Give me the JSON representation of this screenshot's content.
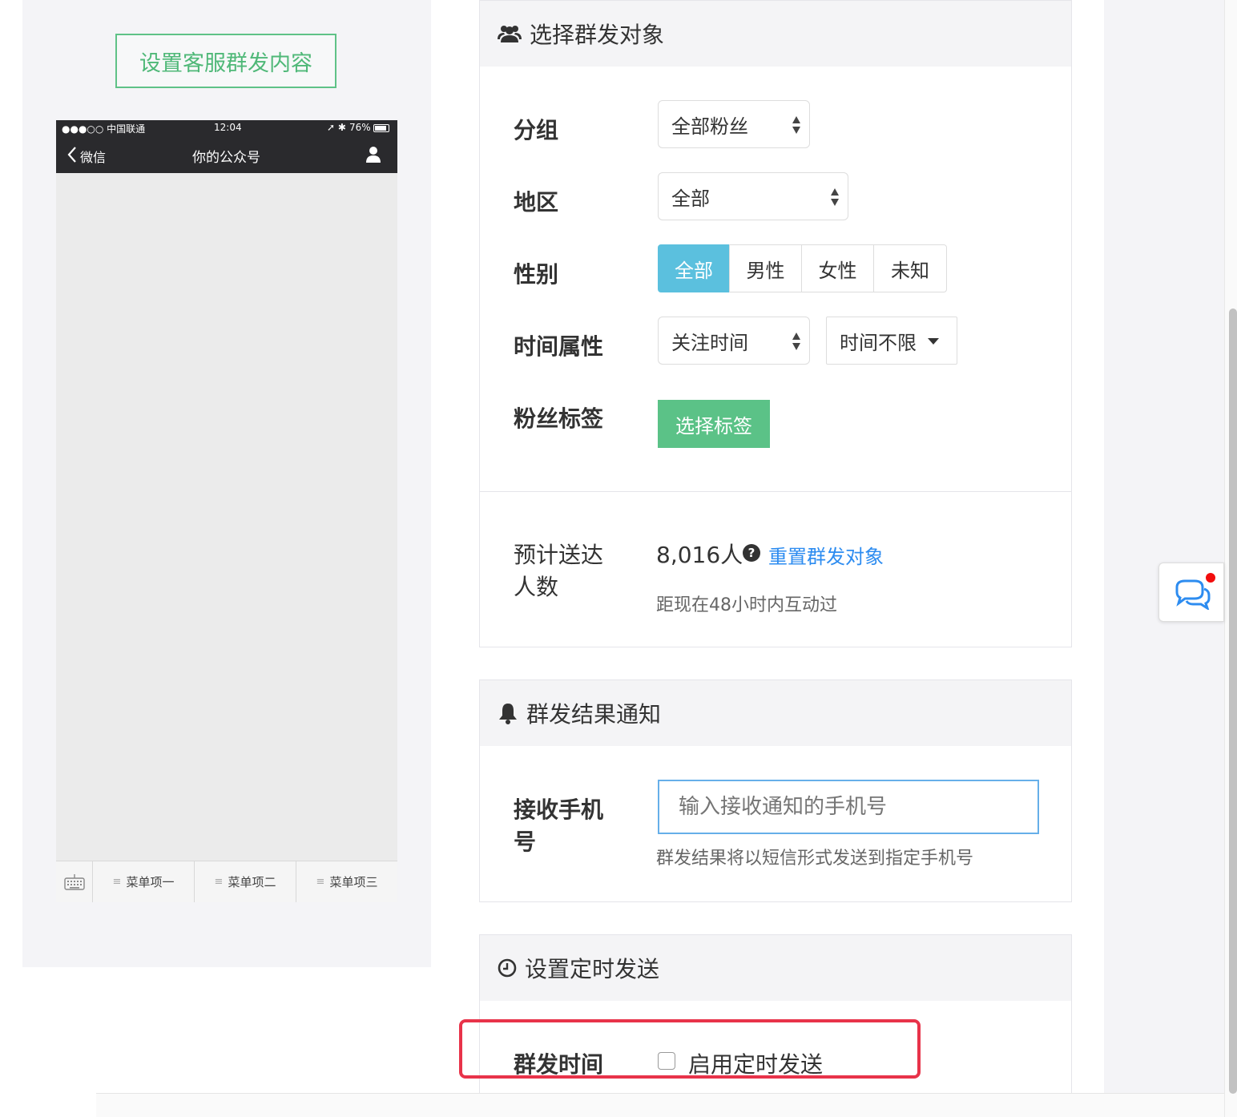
{
  "preview": {
    "setup_button": "设置客服群发内容",
    "status_carrier": "●●●○○ 中国联通",
    "status_time": "12:04",
    "status_battery": "76%",
    "nav_back": "微信",
    "nav_title": "你的公众号",
    "menu_items": [
      "菜单项一",
      "菜单项二",
      "菜单项三"
    ]
  },
  "targets": {
    "title": "选择群发对象",
    "group_label": "分组",
    "group_value": "全部粉丝",
    "region_label": "地区",
    "region_value": "全部",
    "gender_label": "性别",
    "gender_options": [
      "全部",
      "男性",
      "女性",
      "未知"
    ],
    "gender_selected": "全部",
    "time_label": "时间属性",
    "time_attr_value": "关注时间",
    "time_range_value": "时间不限",
    "tags_label": "粉丝标签",
    "tags_button": "选择标签",
    "estimate_label_1": "预计送达",
    "estimate_label_2": "人数",
    "estimate_count": "8,016人",
    "reset_link": "重置群发对象",
    "estimate_note": "距现在48小时内互动过"
  },
  "notify": {
    "title": "群发结果通知",
    "phone_label_1": "接收手机",
    "phone_label_2": "号",
    "phone_placeholder": "输入接收通知的手机号",
    "phone_help": "群发结果将以短信形式发送到指定手机号"
  },
  "schedule": {
    "title": "设置定时发送",
    "time_label": "群发时间",
    "enable_label": "启用定时发送",
    "enabled": false
  },
  "colors": {
    "accent_green": "#5fc287",
    "accent_blue": "#5bc0de",
    "link_blue": "#2d8cf0",
    "highlight_red": "#e8334a"
  }
}
